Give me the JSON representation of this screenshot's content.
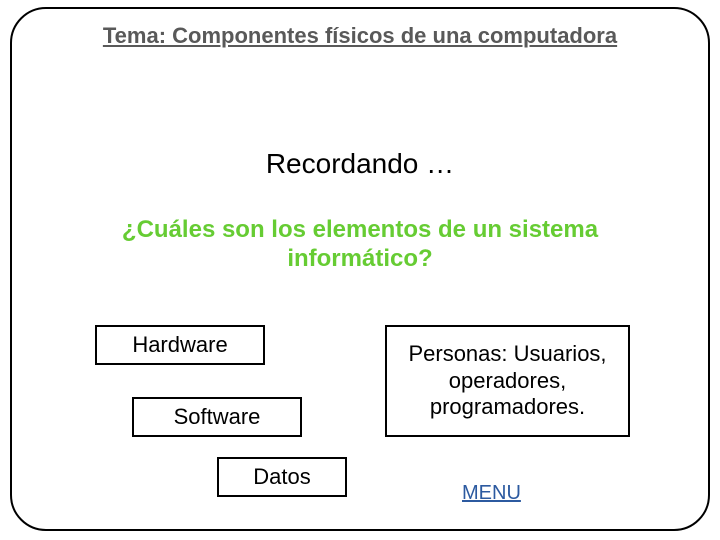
{
  "title": "Tema: Componentes físicos de una computadora",
  "recordando": "Recordando …",
  "question": "¿Cuáles son los elementos de un sistema informático?",
  "boxes": {
    "hardware": "Hardware",
    "software": "Software",
    "datos": "Datos",
    "personas": "Personas: Usuarios, operadores, programadores."
  },
  "menu": "MENU"
}
